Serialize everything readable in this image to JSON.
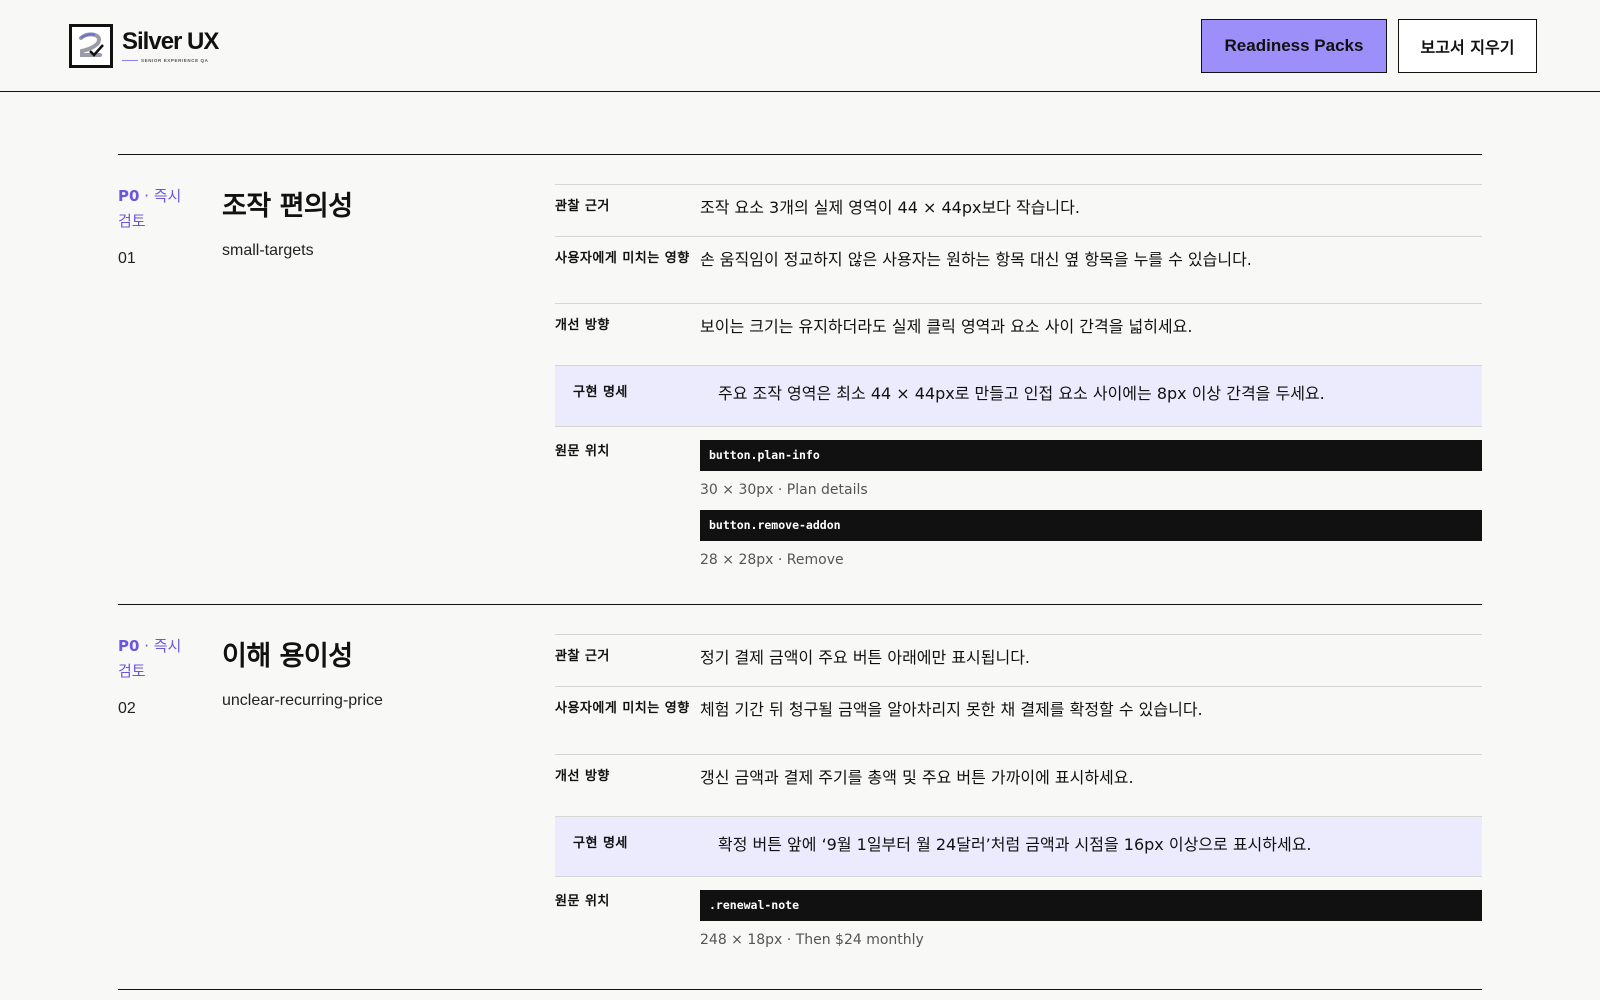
{
  "header": {
    "logo_name": "Silver UX",
    "logo_sub": "SENIOR EXPERIENCE QA",
    "primary_button": "Readiness Packs",
    "secondary_button": "보고서 지우기"
  },
  "labels": {
    "observation": "관찰 근거",
    "impact": "사용자에게 미치는 영향",
    "direction": "개선 방향",
    "spec": "구현 명세",
    "location": "원문 위치"
  },
  "issues": [
    {
      "priority_code": "P0",
      "priority_text": "· 즉시 검토",
      "number": "01",
      "title": "조작 편의성",
      "slug": "small-targets",
      "observation": "조작 요소 3개의 실제 영역이 44 × 44px보다 작습니다.",
      "impact": "손 움직임이 정교하지 않은 사용자는 원하는 항목 대신 옆 항목을 누를 수 있습니다.",
      "direction": "보이는 크기는 유지하더라도 실제 클릭 영역과 요소 사이 간격을 넓히세요.",
      "spec": "주요 조작 영역은 최소 44 × 44px로 만들고 인접 요소 사이에는 8px 이상 간격을 두세요.",
      "locations": [
        {
          "selector": "button.plan-info",
          "meta": "30 × 30px · Plan details"
        },
        {
          "selector": "button.remove-addon",
          "meta": "28 × 28px · Remove"
        }
      ]
    },
    {
      "priority_code": "P0",
      "priority_text": "· 즉시 검토",
      "number": "02",
      "title": "이해 용이성",
      "slug": "unclear-recurring-price",
      "observation": "정기 결제 금액이 주요 버튼 아래에만 표시됩니다.",
      "impact": "체험 기간 뒤 청구될 금액을 알아차리지 못한 채 결제를 확정할 수 있습니다.",
      "direction": "갱신 금액과 결제 주기를 총액 및 주요 버튼 가까이에 표시하세요.",
      "spec": "확정 버튼 앞에 ‘9월 1일부터 월 24달러’처럼 금액과 시점을 16px 이상으로 표시하세요.",
      "locations": [
        {
          "selector": ".renewal-note",
          "meta": "248 × 18px · Then $24 monthly"
        }
      ]
    }
  ]
}
